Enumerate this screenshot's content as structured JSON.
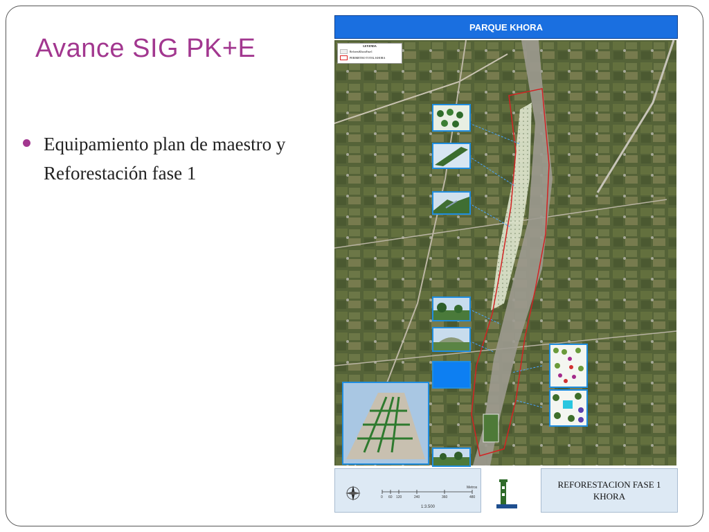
{
  "slide": {
    "title": "Avance SIG PK+E",
    "bullet": "Equipamiento plan de maestro y Reforestación fase 1"
  },
  "map": {
    "header": "PARQUE KHORA",
    "legend": {
      "title": "LEYENDA",
      "items": [
        "ReforestKhoraFase1",
        "PERIMETRO TOTAL KHORA"
      ]
    }
  },
  "footer": {
    "scale_text": "1:3.500",
    "scale_unit": "Metros",
    "scale_ticks": [
      "0",
      "60",
      "120",
      "240",
      "360",
      "480"
    ],
    "caption_line1": "REFORESTACION FASE 1",
    "caption_line2": "KHORA"
  },
  "colors": {
    "title": "#a2378f",
    "header_blue": "#1a6fe0",
    "perimeter": "#d22222"
  }
}
